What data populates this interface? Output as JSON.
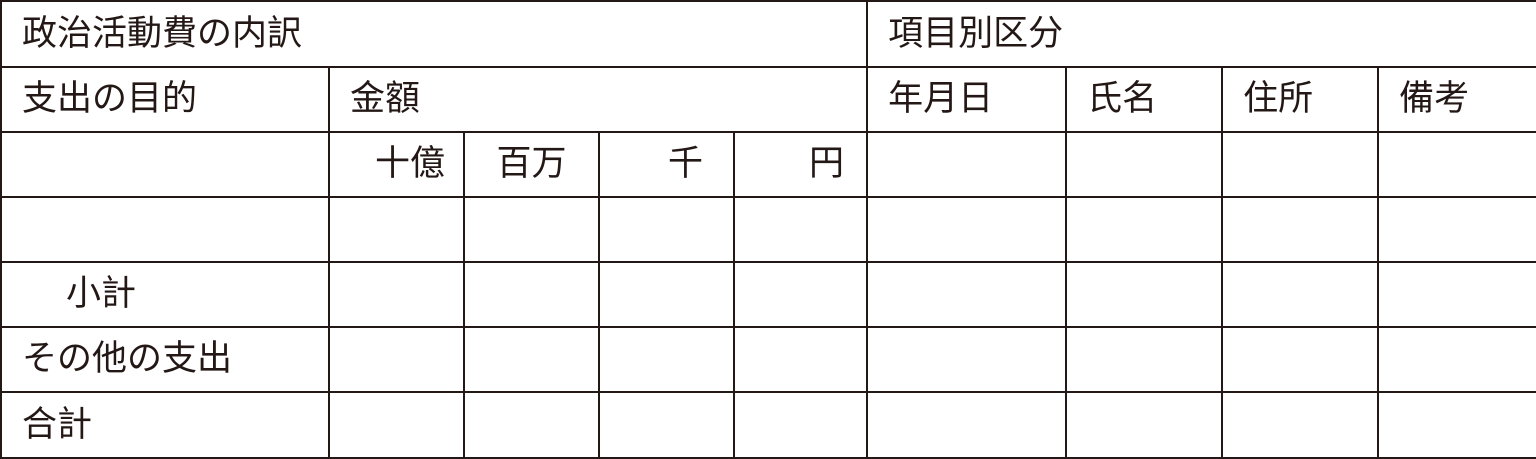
{
  "header": {
    "breakdown_title": "政治活動費の内訳",
    "category_title": "項目別区分"
  },
  "columns": {
    "purpose": "支出の目的",
    "amount": "金額",
    "date": "年月日",
    "name": "氏名",
    "address": "住所",
    "remarks": "備考"
  },
  "amount_units": {
    "billion": "十億",
    "million": "百万",
    "thousand": "千",
    "yen": "円"
  },
  "rows": {
    "subtotal": "小計",
    "other_expenses": "その他の支出",
    "total": "合計"
  },
  "colors": {
    "ink": "#231815",
    "background": "#ffffff"
  }
}
